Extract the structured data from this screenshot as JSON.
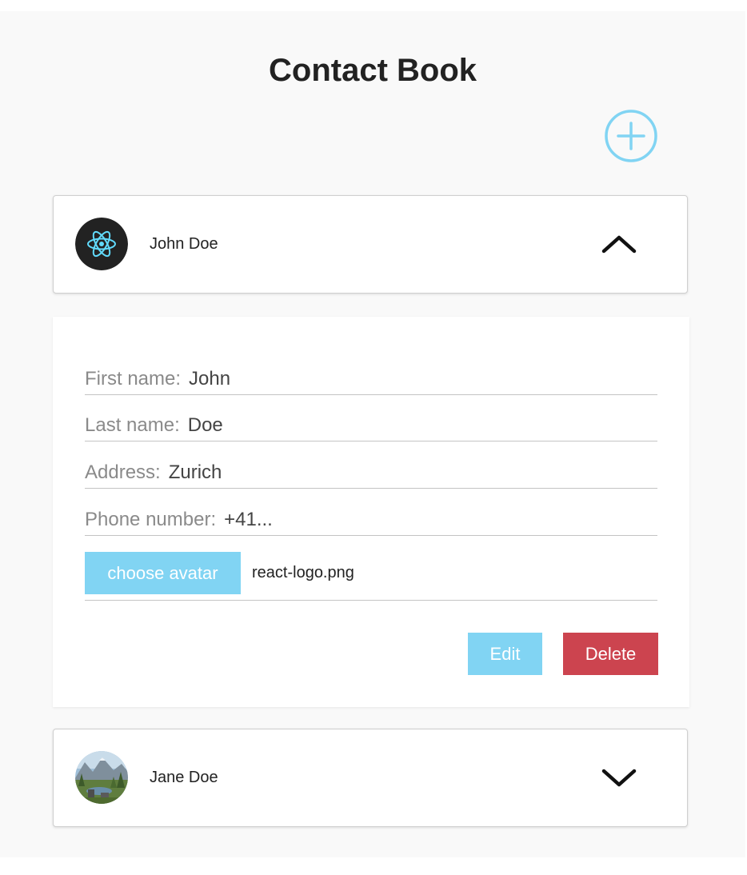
{
  "app": {
    "title": "Contact Book"
  },
  "colors": {
    "accent": "#81d4f3",
    "danger": "#cc444f",
    "text": "#222222",
    "label": "#8a8a8a",
    "background": "#f9f9f9"
  },
  "add_button": {
    "icon": "plus-circle-icon"
  },
  "contacts": [
    {
      "name": "John Doe",
      "avatar": "react-logo-avatar",
      "expanded": true,
      "toggle_icon": "chevron-up-icon"
    },
    {
      "name": "Jane Doe",
      "avatar": "landscape-photo-avatar",
      "expanded": false,
      "toggle_icon": "chevron-down-icon"
    }
  ],
  "details": {
    "fields": [
      {
        "label": "First name:",
        "value": "John"
      },
      {
        "label": "Last name:",
        "value": "Doe"
      },
      {
        "label": "Address:",
        "value": "Zurich"
      },
      {
        "label": "Phone number:",
        "value": "+41..."
      }
    ],
    "choose_avatar_label": "choose avatar",
    "file_name": "react-logo.png",
    "edit_label": "Edit",
    "delete_label": "Delete"
  }
}
